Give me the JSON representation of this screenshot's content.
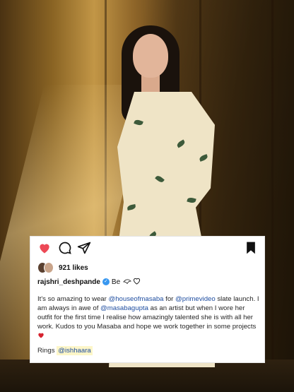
{
  "post": {
    "likes_text": "921 likes",
    "username": "rajshri_deshpande",
    "verified_glyph": "✓",
    "bio_snippet": "Be",
    "caption": {
      "p1": "It's so amazing to wear ",
      "m1": "@houseofmasaba",
      "p2": " for ",
      "m2": "@primevideo",
      "p3": " slate launch. I am always in awe of ",
      "m3": "@masabagupta",
      "p4": " as an artist but when I wore her outfit for the first time I realise how amazingly talented she is with all her work. Kudos to you Masaba and hope we work together in some projects ",
      "heart": "❤️"
    },
    "rings_label": "Rings ",
    "rings_mention": "@ishhaara"
  },
  "icons": [
    "heart-icon",
    "comment-icon",
    "share-icon",
    "bookmark-icon"
  ],
  "colors": {
    "heart": "#ed4956",
    "verified": "#3897f0",
    "mention": "#1f4ea0"
  }
}
